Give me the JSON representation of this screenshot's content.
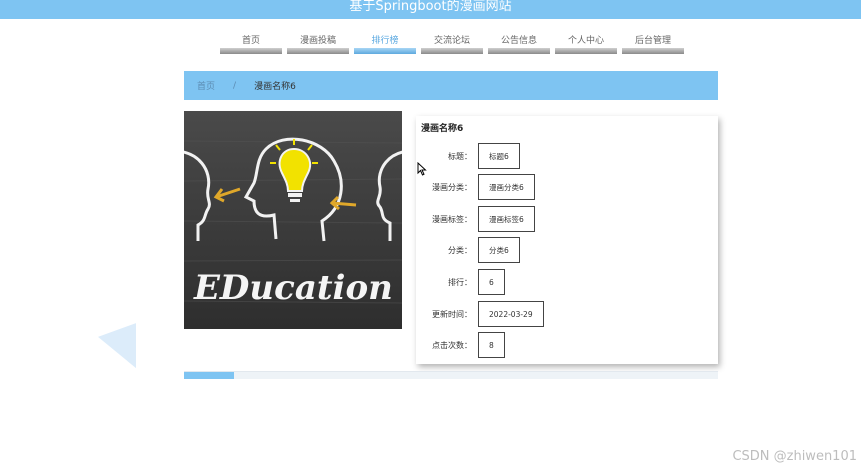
{
  "site": {
    "title": "基于Springboot的漫画网站"
  },
  "nav": {
    "items": [
      {
        "label": "首页",
        "active": false
      },
      {
        "label": "漫画投稿",
        "active": false
      },
      {
        "label": "排行榜",
        "active": true
      },
      {
        "label": "交流论坛",
        "active": false
      },
      {
        "label": "公告信息",
        "active": false
      },
      {
        "label": "个人中心",
        "active": false
      },
      {
        "label": "后台管理",
        "active": false
      }
    ]
  },
  "breadcrumb": {
    "home": "首页",
    "separator": "/",
    "current": "漫画名称6"
  },
  "cover": {
    "text": "EDucation",
    "bg_color": "#3c3c3c",
    "bulb_color": "#f2e200",
    "arrow_color": "#e0a82a"
  },
  "detail": {
    "title": "漫画名称6",
    "fields": [
      {
        "label": "标题：",
        "value": "标题6"
      },
      {
        "label": "漫画分类：",
        "value": "漫画分类6"
      },
      {
        "label": "漫画标签：",
        "value": "漫画标签6"
      },
      {
        "label": "分类：",
        "value": "分类6"
      },
      {
        "label": "排行：",
        "value": "6"
      },
      {
        "label": "更新时间：",
        "value": "2022-03-29"
      },
      {
        "label": "点击次数：",
        "value": "8"
      }
    ]
  },
  "colors": {
    "accent": "#7ec4f2",
    "active_nav": "#5aa8e0"
  },
  "watermark": "CSDN @zhiwen101"
}
